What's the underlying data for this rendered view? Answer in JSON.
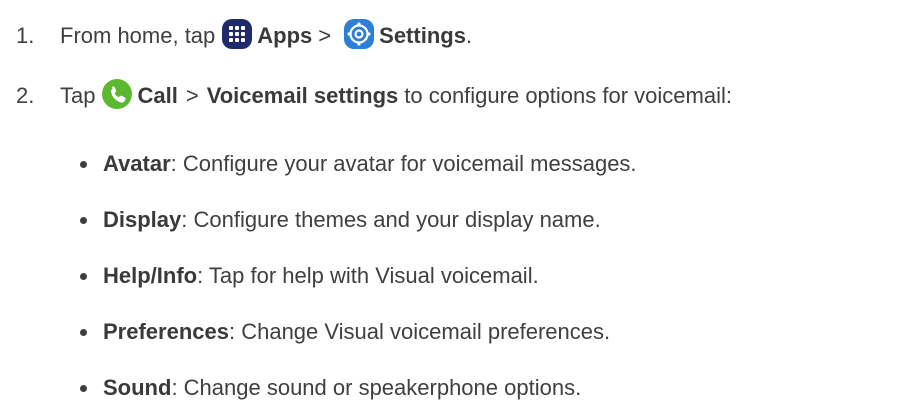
{
  "steps": [
    {
      "number": "1.",
      "text_before": "From home, tap",
      "icon1": "apps-icon",
      "label1": "Apps",
      "separator": ">",
      "icon2": "settings-icon",
      "label2": "Settings",
      "suffix": "."
    },
    {
      "number": "2.",
      "text_before": "Tap",
      "icon1": "call-icon",
      "label1": "Call",
      "separator": ">",
      "label2": "Voicemail settings",
      "suffix": "to configure options for voicemail:"
    }
  ],
  "options": [
    {
      "name": "Avatar",
      "description": ": Configure your avatar for voicemail messages."
    },
    {
      "name": "Display",
      "description": ": Configure themes and your display name."
    },
    {
      "name": "Help/Info",
      "description": ": Tap for help with Visual voicemail."
    },
    {
      "name": "Preferences",
      "description": ": Change Visual voicemail preferences."
    },
    {
      "name": "Sound",
      "description": ": Change sound or speakerphone options."
    }
  ],
  "colors": {
    "text": "#3f3f3f",
    "apps_icon_bg": "#1f2a6b",
    "settings_icon_bg": "#2b7fd6",
    "call_icon_bg": "#5cb82e"
  }
}
